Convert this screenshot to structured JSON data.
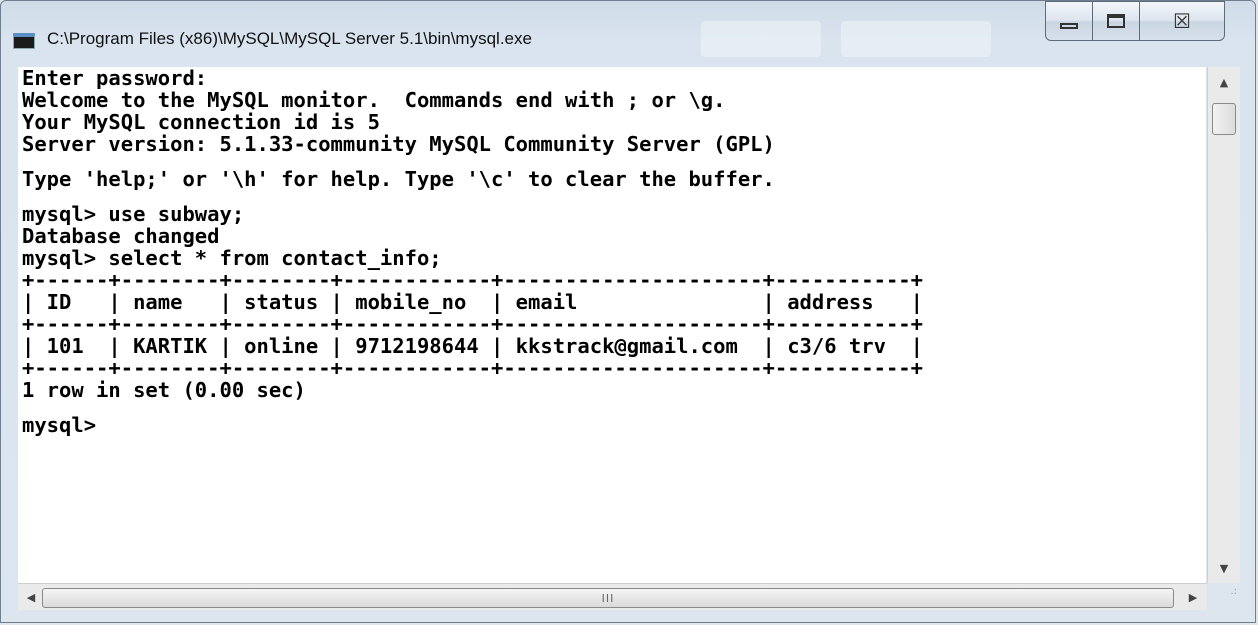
{
  "window": {
    "title": "C:\\Program Files (x86)\\MySQL\\MySQL Server 5.1\\bin\\mysql.exe",
    "icon": "console-app-icon",
    "controls": {
      "minimize": "minimize-icon",
      "maximize": "maximize-icon",
      "close": "close-icon",
      "close_glyph": "☒"
    }
  },
  "console": {
    "lines": [
      "Enter password:",
      "Welcome to the MySQL monitor.  Commands end with ; or \\g.",
      "Your MySQL connection id is 5",
      "Server version: 5.1.33-community MySQL Community Server (GPL)",
      "",
      "Type 'help;' or '\\h' for help. Type '\\c' to clear the buffer.",
      "",
      "mysql> use subway;",
      "Database changed",
      "mysql> select * from contact_info;",
      "+------+--------+--------+------------+---------------------+-----------+",
      "| ID   | name   | status | mobile_no  | email               | address   |",
      "+------+--------+--------+------------+---------------------+-----------+",
      "| 101  | KARTIK | online | 9712198644 | kkstrack@gmail.com  | c3/6 trv  |",
      "+------+--------+--------+------------+---------------------+-----------+",
      "1 row in set (0.00 sec)",
      "",
      "mysql>"
    ],
    "table": {
      "columns": [
        "ID",
        "name",
        "status",
        "mobile_no",
        "email",
        "address"
      ],
      "rows": [
        [
          "101",
          "KARTIK",
          "online",
          "9712198644",
          "kkstrack@gmail.com",
          "c3/6 trv"
        ]
      ]
    }
  },
  "scrollbars": {
    "up_arrow": "▲",
    "down_arrow": "▼",
    "left_arrow": "◀",
    "right_arrow": "▶",
    "h_thumb_grip": "III",
    "size_grip": ".:"
  }
}
